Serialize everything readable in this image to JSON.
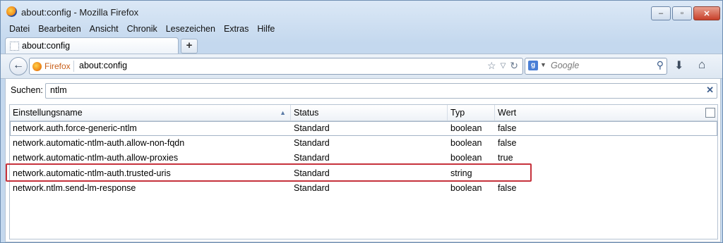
{
  "window": {
    "title": "about:config - Mozilla Firefox",
    "controls": {
      "minimize": "‒",
      "maximize": "▫",
      "close": "✕"
    }
  },
  "menu": [
    "Datei",
    "Bearbeiten",
    "Ansicht",
    "Chronik",
    "Lesezeichen",
    "Extras",
    "Hilfe"
  ],
  "tabs": [
    {
      "label": "about:config",
      "active": true
    }
  ],
  "newtab_label": "+",
  "navbar": {
    "back_icon": "back-arrow-icon",
    "identity_label": "Firefox",
    "url": "about:config",
    "search_engine_icon": "google-icon",
    "search_placeholder": "Google"
  },
  "filter": {
    "label": "Suchen:",
    "value": "ntlm"
  },
  "table": {
    "columns": [
      "Einstellungsname",
      "Status",
      "Typ",
      "Wert"
    ],
    "rows": [
      {
        "name": "network.auth.force-generic-ntlm",
        "status": "Standard",
        "type": "boolean",
        "value": "false"
      },
      {
        "name": "network.automatic-ntlm-auth.allow-non-fqdn",
        "status": "Standard",
        "type": "boolean",
        "value": "false"
      },
      {
        "name": "network.automatic-ntlm-auth.allow-proxies",
        "status": "Standard",
        "type": "boolean",
        "value": "true"
      },
      {
        "name": "network.automatic-ntlm-auth.trusted-uris",
        "status": "Standard",
        "type": "string",
        "value": ""
      },
      {
        "name": "network.ntlm.send-lm-response",
        "status": "Standard",
        "type": "boolean",
        "value": "false"
      }
    ]
  },
  "highlight_color": "#c6323c"
}
